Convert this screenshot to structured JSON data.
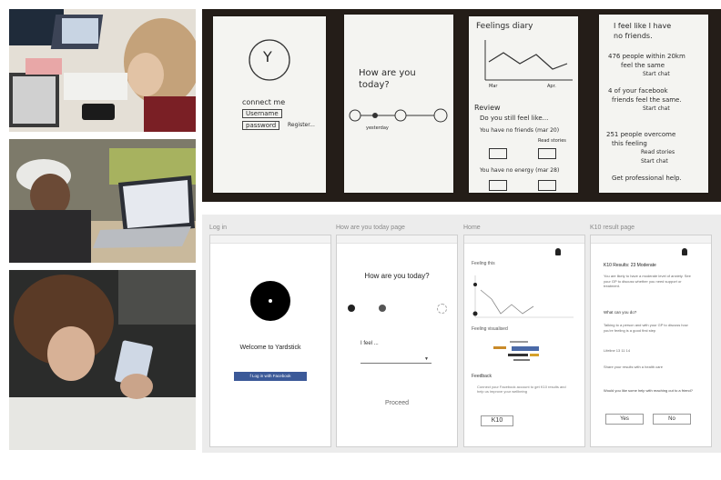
{
  "sketches": {
    "card1": {
      "logo": "Y",
      "connect": "connect me",
      "username": "Username",
      "password": "password",
      "register": "Register..."
    },
    "card2": {
      "question": "How are you today?",
      "yesterday": "yesterday"
    },
    "card3": {
      "title": "Feelings diary",
      "axis_start": "Mar",
      "axis_end": "Apr.",
      "review": "Review",
      "still": "Do you still feel like...",
      "item1": "You have no friends (mar 20)",
      "item2": "You have no energy (mar 28)",
      "read": "Read stories"
    },
    "card4": {
      "l1": "I feel like I have",
      "l2": "no friends.",
      "l3": "476 people within 20km",
      "l4": "feel the same",
      "l5": "Start chat",
      "l6": "4 of your facebook",
      "l7": "friends feel the same.",
      "l8": "Start chat",
      "l9": "251 people overcome",
      "l10": "this feeling",
      "l11": "Read stories",
      "l12": "Start chat",
      "l13": "Get professional help."
    }
  },
  "mockups": {
    "labels": [
      "Log in",
      "How are you today page",
      "Home",
      "K10 result page"
    ],
    "login": {
      "welcome": "Welcome to Yardstick",
      "fb_button": "f  Log in with Facebook"
    },
    "mood": {
      "question": "How are you today?",
      "field_label": "I feel ...",
      "proceed": "Proceed"
    },
    "home": {
      "section_feeling": "Feeling this",
      "section_wordcloud": "Feeling visualised",
      "section_feedback": "Feedback",
      "feedback_text": "Connect your Facebook account to get K10 results and help us improve your wellbeing",
      "k10": "K10"
    },
    "k10": {
      "title": "K10 Results: 23 Moderate",
      "body": "You are likely to have a moderate level of anxiety. See your GP to discuss whether you need support or treatment.",
      "what": "What can you do?",
      "help": "Talking to a person and with your GP to discuss how you're feeling is a good first step",
      "lifeline": "Lifeline 13 11 14",
      "sleep": "Share your results with a health care",
      "question": "Would you like some help with reaching out to a friend?",
      "yes": "Yes",
      "no": "No"
    }
  }
}
